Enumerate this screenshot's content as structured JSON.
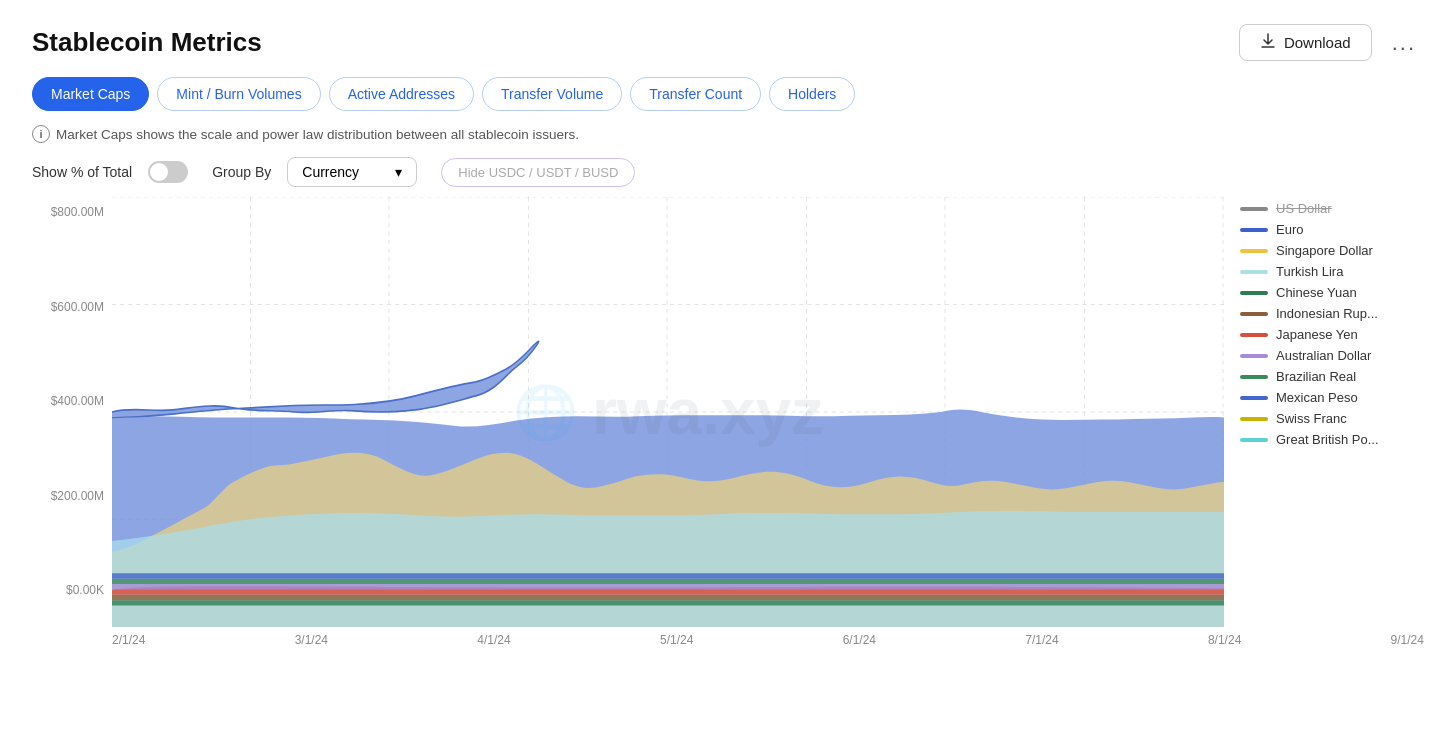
{
  "page": {
    "title": "Stablecoin Metrics"
  },
  "header": {
    "download_label": "Download",
    "more_label": "..."
  },
  "tabs": [
    {
      "id": "market-caps",
      "label": "Market Caps",
      "active": true
    },
    {
      "id": "mint-burn",
      "label": "Mint / Burn Volumes",
      "active": false
    },
    {
      "id": "active-addresses",
      "label": "Active Addresses",
      "active": false
    },
    {
      "id": "transfer-volume",
      "label": "Transfer Volume",
      "active": false
    },
    {
      "id": "transfer-count",
      "label": "Transfer Count",
      "active": false
    },
    {
      "id": "holders",
      "label": "Holders",
      "active": false
    }
  ],
  "info": {
    "text": "Market Caps shows the scale and power law distribution between all stablecoin issuers."
  },
  "controls": {
    "show_pct_label": "Show % of Total",
    "group_by_label": "Group By",
    "currency_label": "Currency",
    "hide_btn_label": "Hide USDC / USDT / BUSD"
  },
  "y_axis": {
    "labels": [
      "$800.00M",
      "$600.00M",
      "$400.00M",
      "$200.00M",
      "$0.00K"
    ]
  },
  "x_axis": {
    "labels": [
      "2/1/24",
      "3/1/24",
      "4/1/24",
      "5/1/24",
      "6/1/24",
      "7/1/24",
      "8/1/24",
      "9/1/24"
    ]
  },
  "legend": [
    {
      "id": "us-dollar",
      "label": "US Dollar",
      "color": "#555555",
      "strikethrough": true
    },
    {
      "id": "euro",
      "label": "Euro",
      "color": "#3b5fcc"
    },
    {
      "id": "singapore-dollar",
      "label": "Singapore Dollar",
      "color": "#f0c040"
    },
    {
      "id": "turkish-lira",
      "label": "Turkish Lira",
      "color": "#a8e0e8"
    },
    {
      "id": "chinese-yuan",
      "label": "Chinese Yuan",
      "color": "#2e7d52"
    },
    {
      "id": "indonesian-rupiah",
      "label": "Indonesian Rup...",
      "color": "#6b4c2a"
    },
    {
      "id": "japanese-yen",
      "label": "Japanese Yen",
      "color": "#d94f3d"
    },
    {
      "id": "australian-dollar",
      "label": "Australian Dollar",
      "color": "#a78bda"
    },
    {
      "id": "brazilian-real",
      "label": "Brazilian Real",
      "color": "#3a8a5c"
    },
    {
      "id": "mexican-peso",
      "label": "Mexican Peso",
      "color": "#4466cc"
    },
    {
      "id": "swiss-franc",
      "label": "Swiss Franc",
      "color": "#c8b400"
    },
    {
      "id": "great-british-pound",
      "label": "Great British Po...",
      "color": "#5cd4d4"
    }
  ],
  "chart": {
    "watermark": "rwa.xyz"
  },
  "colors": {
    "euro_fill": "#5b7fe0",
    "euro_area": "#8fa8ee",
    "turkish_lira": "#b8e8f0",
    "swiss_franc": "#e8d080",
    "accent_blue": "#2563eb"
  }
}
